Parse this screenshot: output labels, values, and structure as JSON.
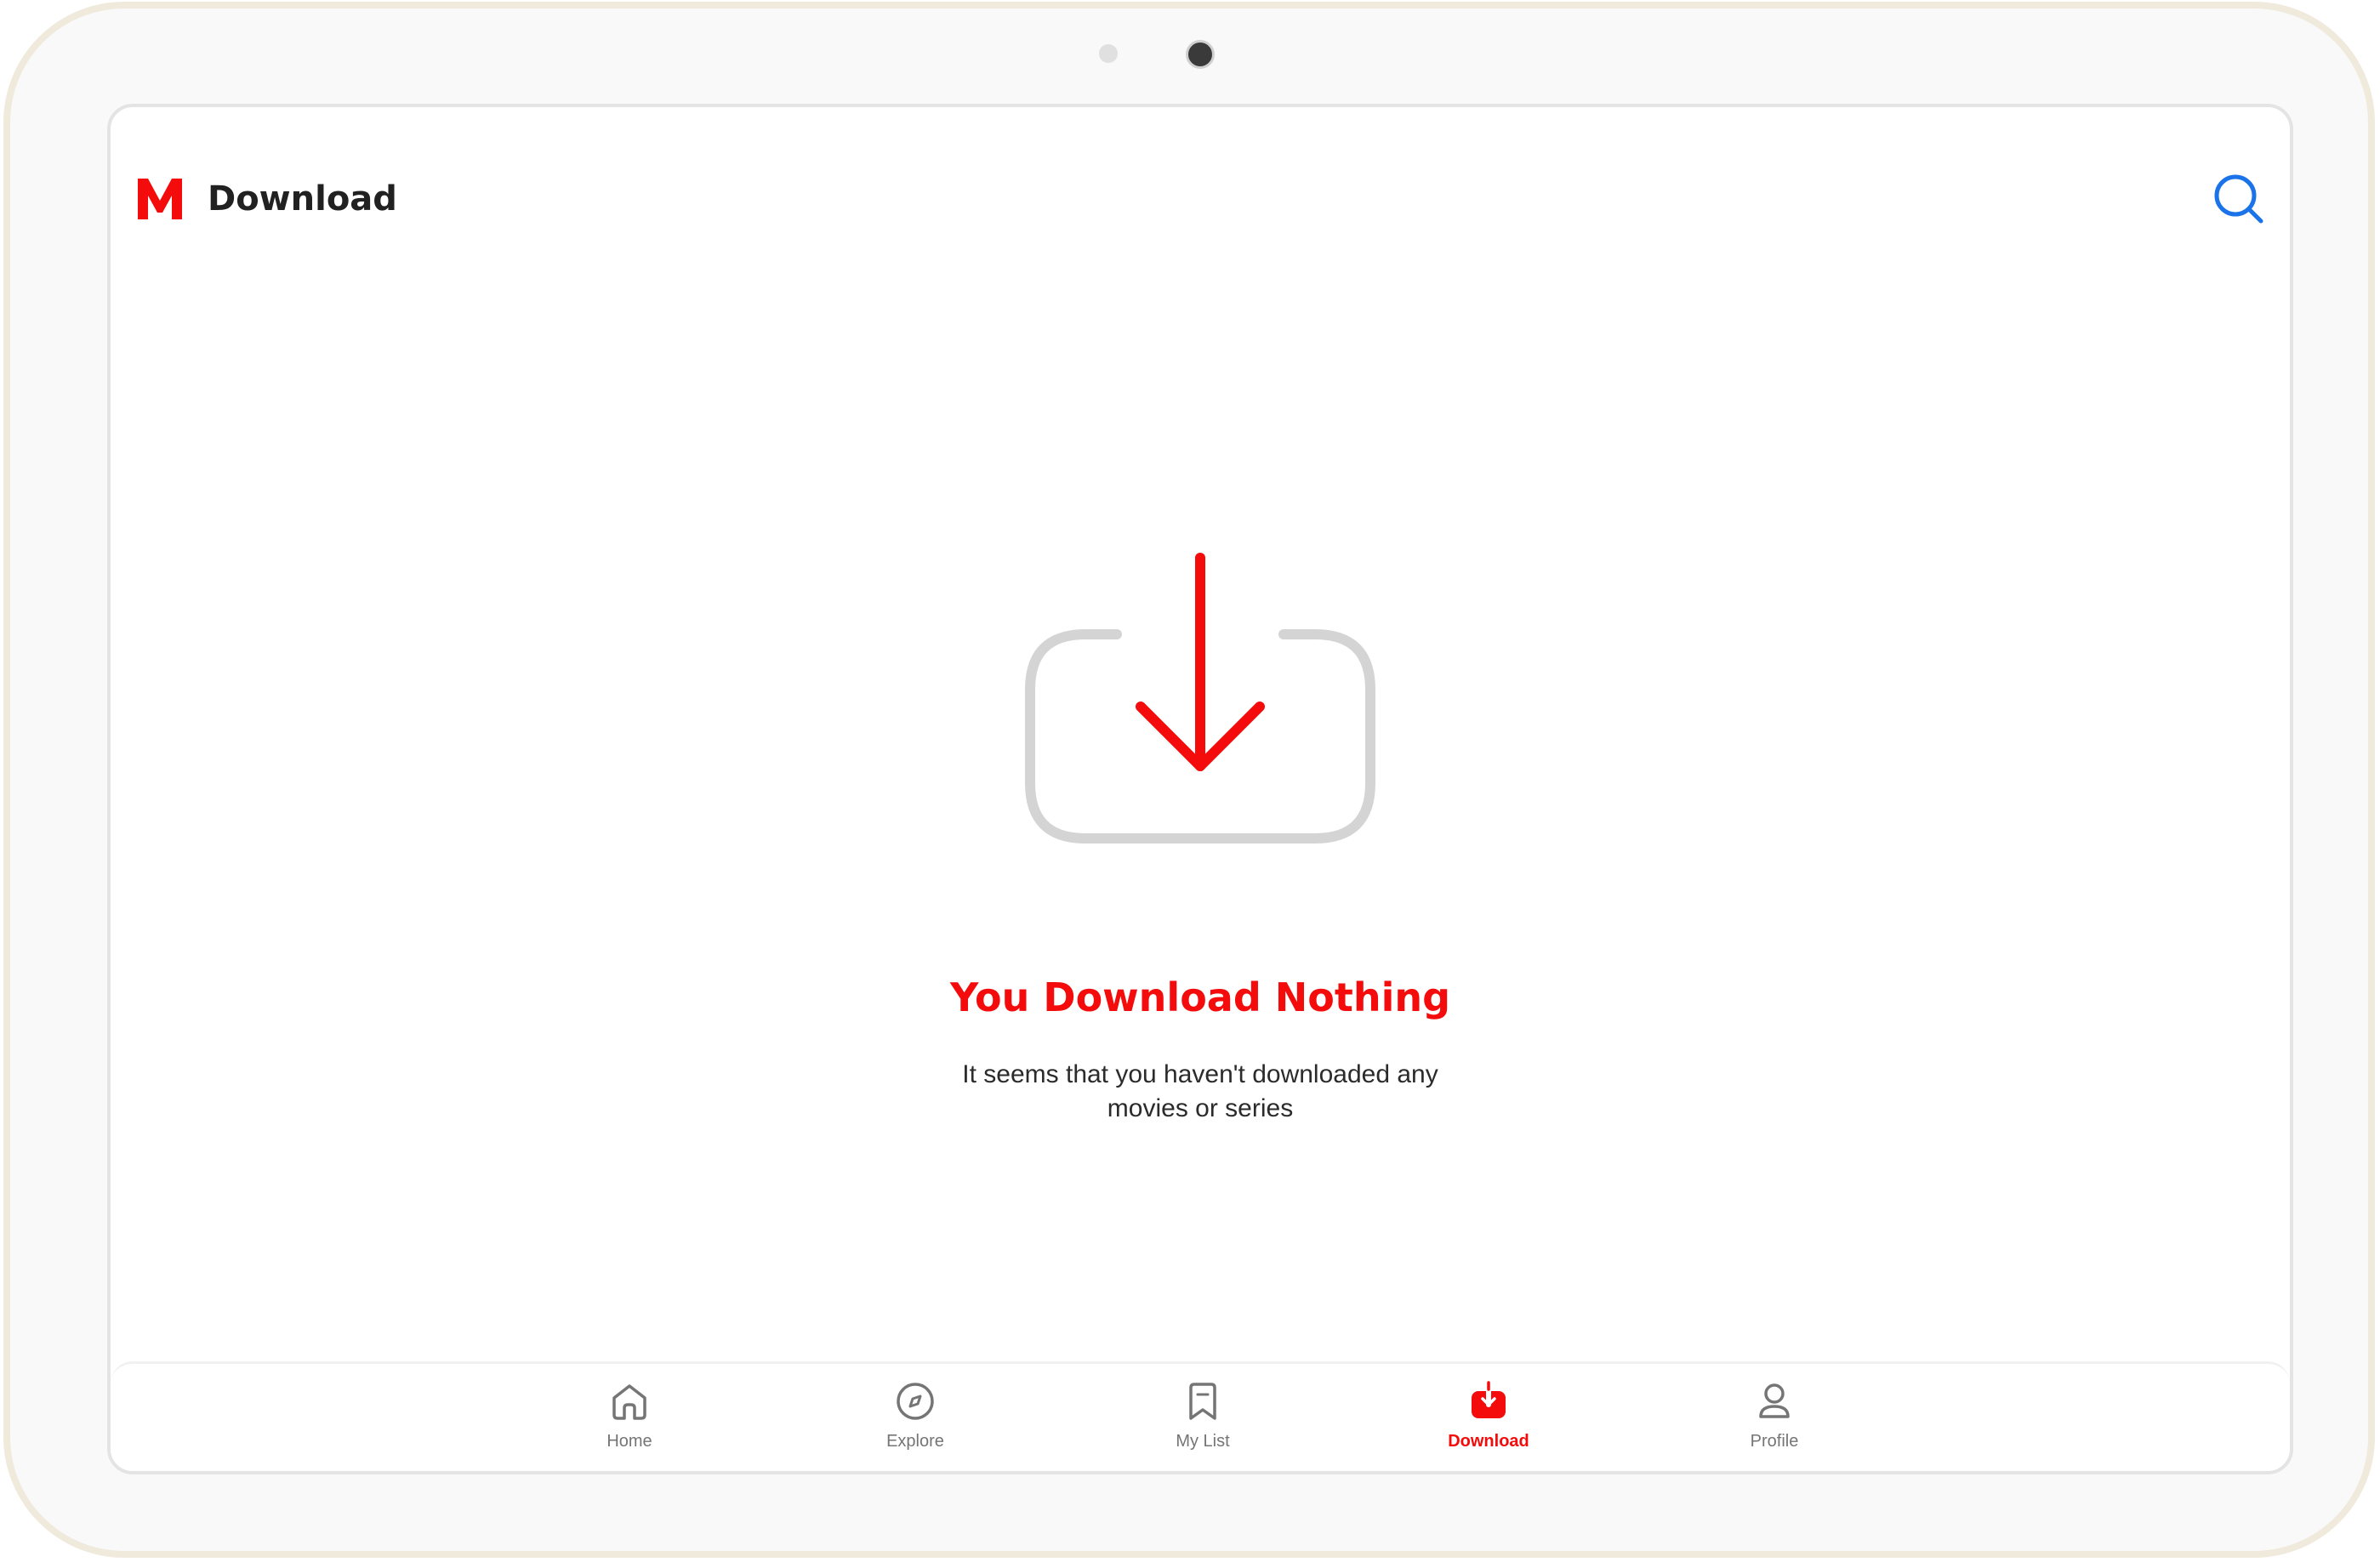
{
  "header": {
    "title": "Download",
    "logo_icon": "netflix-m-logo",
    "search_icon": "search-icon"
  },
  "empty_state": {
    "icon": "download-tray-icon",
    "title": "You Download Nothing",
    "description": "It seems that you haven't downloaded any movies or series"
  },
  "nav": {
    "items": [
      {
        "label": "Home",
        "icon": "home-icon",
        "active": false
      },
      {
        "label": "Explore",
        "icon": "compass-icon",
        "active": false
      },
      {
        "label": "My List",
        "icon": "bookmark-icon",
        "active": false
      },
      {
        "label": "Download",
        "icon": "download-icon",
        "active": true
      },
      {
        "label": "Profile",
        "icon": "user-icon",
        "active": false
      }
    ]
  },
  "colors": {
    "accent": "#f40b0b",
    "search": "#1a73e8",
    "muted": "#757575",
    "tray": "#d4d4d4"
  }
}
